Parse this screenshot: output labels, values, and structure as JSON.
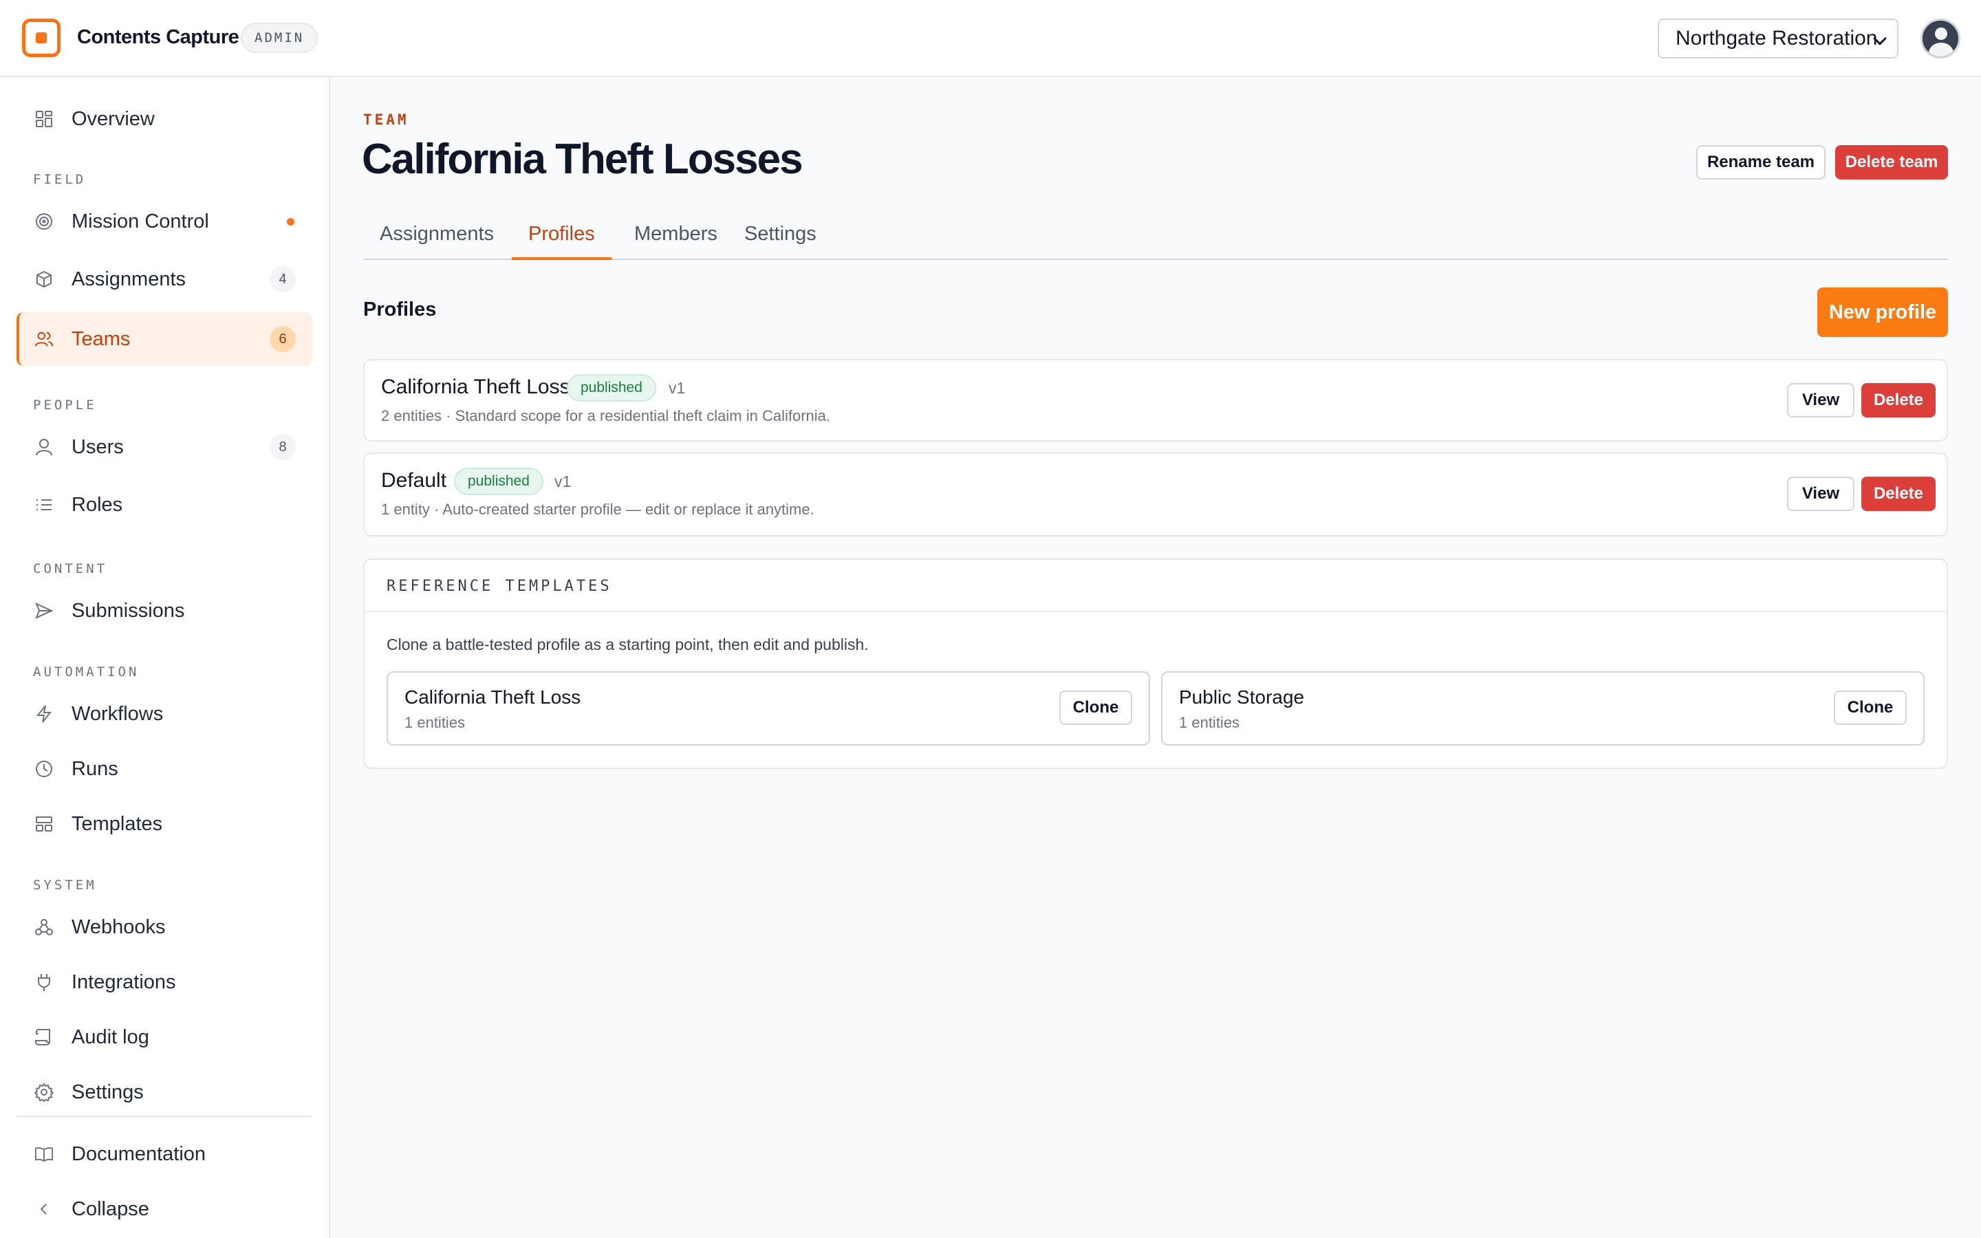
{
  "app": {
    "title": "Contents Capture",
    "badge": "ADMIN"
  },
  "header": {
    "org_selected": "Northgate Restoration"
  },
  "sidebar": {
    "top_items": [
      {
        "label": "Overview",
        "icon": "grid-icon"
      }
    ],
    "sections": [
      {
        "label": "FIELD",
        "items": [
          {
            "label": "Mission Control",
            "icon": "target-icon",
            "dot": true
          },
          {
            "label": "Assignments",
            "icon": "cube-icon",
            "count": "4"
          },
          {
            "label": "Teams",
            "icon": "users-icon",
            "count": "6",
            "active": true
          }
        ]
      },
      {
        "label": "PEOPLE",
        "items": [
          {
            "label": "Users",
            "icon": "user-icon",
            "count": "8"
          },
          {
            "label": "Roles",
            "icon": "list-icon"
          }
        ]
      },
      {
        "label": "CONTENT",
        "items": [
          {
            "label": "Submissions",
            "icon": "send-icon"
          }
        ]
      },
      {
        "label": "AUTOMATION",
        "items": [
          {
            "label": "Workflows",
            "icon": "bolt-icon"
          },
          {
            "label": "Runs",
            "icon": "clock-icon"
          },
          {
            "label": "Templates",
            "icon": "layout-icon"
          }
        ]
      },
      {
        "label": "SYSTEM",
        "items": [
          {
            "label": "Webhooks",
            "icon": "webhook-icon"
          },
          {
            "label": "Integrations",
            "icon": "plug-icon"
          },
          {
            "label": "Audit log",
            "icon": "scroll-icon"
          },
          {
            "label": "Settings",
            "icon": "gear-icon"
          }
        ]
      }
    ],
    "footer_items": [
      {
        "label": "Documentation",
        "icon": "book-icon"
      },
      {
        "label": "Collapse",
        "icon": "chevron-left-icon"
      }
    ]
  },
  "page": {
    "eyebrow": "TEAM",
    "title": "California Theft Losses",
    "rename_label": "Rename team",
    "delete_label": "Delete team",
    "tabs": [
      {
        "label": "Assignments"
      },
      {
        "label": "Profiles",
        "active": true
      },
      {
        "label": "Members"
      },
      {
        "label": "Settings"
      }
    ],
    "profiles_heading": "Profiles",
    "new_profile_label": "New profile",
    "profiles": [
      {
        "name": "California Theft Loss",
        "status": "published",
        "version": "v1",
        "description": "2 entities · Standard scope for a residential theft claim in California.",
        "view_label": "View",
        "delete_label": "Delete"
      },
      {
        "name": "Default",
        "status": "published",
        "version": "v1",
        "description": "1 entity · Auto-created starter profile — edit or replace it anytime.",
        "view_label": "View",
        "delete_label": "Delete"
      }
    ],
    "reference": {
      "label": "REFERENCE TEMPLATES",
      "description": "Clone a battle-tested profile as a starting point, then edit and publish.",
      "templates": [
        {
          "name": "California Theft Loss",
          "sub": "1 entities",
          "clone_label": "Clone"
        },
        {
          "name": "Public Storage",
          "sub": "1 entities",
          "clone_label": "Clone"
        }
      ]
    }
  },
  "colors": {
    "accent": "#f97316",
    "danger": "#dc3f3a",
    "success": "#15803d"
  }
}
